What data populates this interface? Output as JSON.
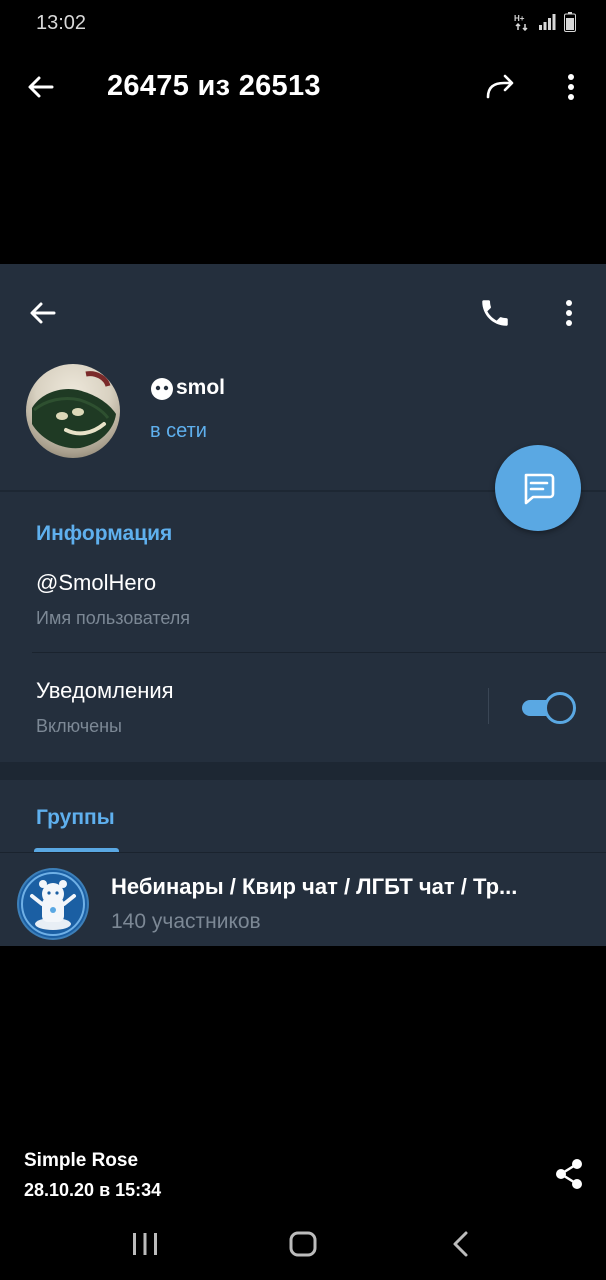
{
  "status_bar": {
    "time": "13:02",
    "icons": [
      "network-type-icon",
      "signal-icon",
      "battery-icon"
    ]
  },
  "viewer": {
    "counter": "26475 из 26513",
    "icons": [
      "back-arrow-icon",
      "forward-icon",
      "more-vert-icon"
    ]
  },
  "profile": {
    "name": "smol",
    "status": "в сети",
    "icons": [
      "back-arrow-icon",
      "phone-icon",
      "more-vert-icon",
      "message-icon"
    ],
    "accent_color": "#5fb0ee",
    "fab_color": "#5aa8e3"
  },
  "info": {
    "title": "Информация",
    "username": "@SmolHero",
    "username_label": "Имя пользователя",
    "notifications_title": "Уведомления",
    "notifications_state": "Включены",
    "notifications_enabled": true
  },
  "groups": {
    "tab_label": "Группы",
    "items": [
      {
        "title": "Небинары / Квир чат / ЛГБТ чат / Тр...",
        "members": "140 участников"
      }
    ]
  },
  "footer": {
    "sender": "Simple Rose",
    "date": "28.10.20 в 15:34",
    "icons": [
      "share-icon"
    ]
  },
  "nav_bar": {
    "icons": [
      "recents-icon",
      "home-icon",
      "nav-back-icon"
    ]
  }
}
